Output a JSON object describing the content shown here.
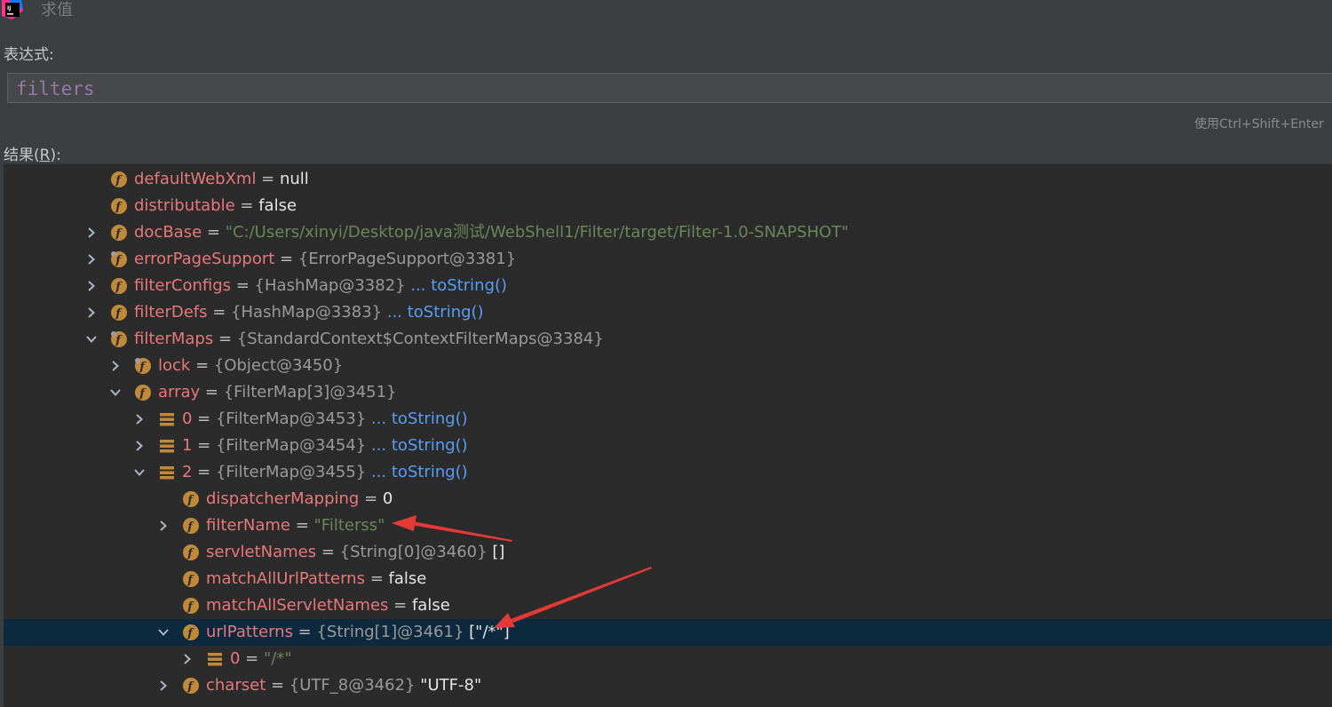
{
  "window": {
    "title": "求值"
  },
  "expression": {
    "label": "表达式:",
    "value": "filters"
  },
  "hint": "使用Ctrl+Shift+Enter",
  "result": {
    "label_prefix": "结果(",
    "mnemonic": "R",
    "label_suffix": "):",
    "rows": [
      {
        "toggle": "none",
        "icon": "field-icon",
        "name": "defaultWebXml",
        "eq": " = ",
        "value": "null"
      },
      {
        "toggle": "none",
        "icon": "field-icon",
        "name": "distributable",
        "eq": " = ",
        "value": "false"
      },
      {
        "toggle": "collapsed",
        "icon": "field-icon",
        "name": "docBase",
        "eq": " = ",
        "string": "\"C:/Users/xinyi/Desktop/java测试/WebShell1/Filter/target/Filter-1.0-SNAPSHOT\""
      },
      {
        "toggle": "collapsed",
        "icon": "field-final-icon",
        "name": "errorPageSupport",
        "eq": " = ",
        "object": "{ErrorPageSupport@3381}"
      },
      {
        "toggle": "collapsed",
        "icon": "field-icon",
        "name": "filterConfigs",
        "eq": " = ",
        "object": "{HashMap@3382}",
        "link": "  ... toString()"
      },
      {
        "toggle": "collapsed",
        "icon": "field-icon",
        "name": "filterDefs",
        "eq": " = ",
        "object": "{HashMap@3383}",
        "link": "  ... toString()"
      },
      {
        "toggle": "expanded",
        "icon": "field-final-icon",
        "name": "filterMaps",
        "eq": " = ",
        "object": "{StandardContext$ContextFilterMaps@3384}"
      },
      {
        "toggle": "collapsed",
        "icon": "field-final-icon",
        "name": "lock",
        "eq": " = ",
        "object": "{Object@3450}"
      },
      {
        "toggle": "expanded",
        "icon": "field-icon",
        "name": "array",
        "eq": " = ",
        "object": "{FilterMap[3]@3451}"
      },
      {
        "toggle": "collapsed",
        "icon": "array-element-icon",
        "name": "0",
        "eq": " = ",
        "object": "{FilterMap@3453}",
        "link": "  ... toString()"
      },
      {
        "toggle": "collapsed",
        "icon": "array-element-icon",
        "name": "1",
        "eq": " = ",
        "object": "{FilterMap@3454}",
        "link": "  ... toString()"
      },
      {
        "toggle": "expanded",
        "icon": "array-element-icon",
        "name": "2",
        "eq": " = ",
        "object": "{FilterMap@3455}",
        "link": "  ... toString()"
      },
      {
        "toggle": "none",
        "icon": "field-icon",
        "name": "dispatcherMapping",
        "eq": " = ",
        "value": "0"
      },
      {
        "toggle": "collapsed",
        "icon": "field-icon",
        "name": "filterName",
        "eq": " = ",
        "string": "\"Filterss\""
      },
      {
        "toggle": "none",
        "icon": "field-icon",
        "name": "servletNames",
        "eq": " = ",
        "object": "{String[0]@3460}",
        "value": " []"
      },
      {
        "toggle": "none",
        "icon": "field-icon",
        "name": "matchAllUrlPatterns",
        "eq": " = ",
        "value": "false"
      },
      {
        "toggle": "none",
        "icon": "field-icon",
        "name": "matchAllServletNames",
        "eq": " = ",
        "value": "false"
      },
      {
        "toggle": "expanded",
        "icon": "field-icon",
        "name": "urlPatterns",
        "eq": " = ",
        "object": "{String[1]@3461}",
        "value": " [\"/*\"]",
        "selected": true
      },
      {
        "toggle": "collapsed",
        "icon": "array-element-icon",
        "name": "0",
        "eq": " = ",
        "string": "\"/*\""
      },
      {
        "toggle": "collapsed",
        "icon": "field-icon",
        "name": "charset",
        "eq": " = ",
        "object": "{UTF_8@3462}",
        "value": " \"UTF-8\""
      }
    ]
  },
  "colors": {
    "background": "#3c3f41",
    "tree_background": "#2b2b2b",
    "selection": "#0d293e",
    "field_name": "#e8787a",
    "string": "#6a8759",
    "object_ref": "#9a9a9a",
    "link": "#589df6",
    "expression": "#9876aa",
    "annotation_arrow": "#e53935"
  }
}
